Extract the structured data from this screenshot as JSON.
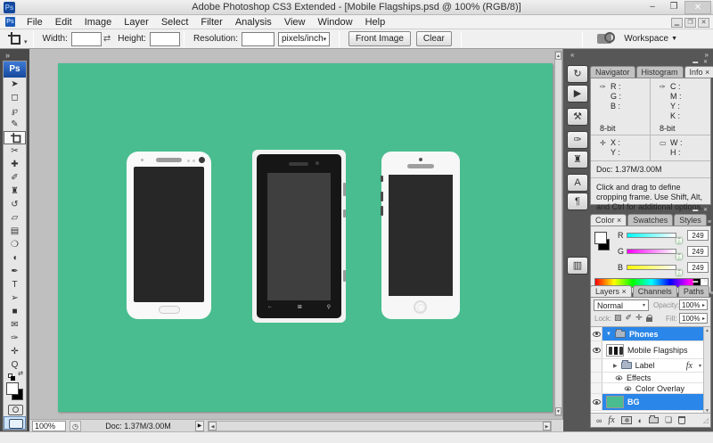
{
  "window": {
    "title": "Adobe Photoshop CS3 Extended - [Mobile Flagships.psd @ 100% (RGB/8)]",
    "logo": "Ps",
    "minimize_glyph": "–",
    "maximize_glyph": "❐",
    "close_glyph": "✕"
  },
  "doc_window": {
    "minimize_glyph": "▁",
    "restore_glyph": "❐",
    "close_glyph": "✕"
  },
  "menu": {
    "items": [
      "File",
      "Edit",
      "Image",
      "Layer",
      "Select",
      "Filter",
      "Analysis",
      "View",
      "Window",
      "Help"
    ],
    "doc_icon": "Ps"
  },
  "options": {
    "tool_caret": "▾",
    "width_label": "Width:",
    "width_value": "",
    "swap_glyph": "⇄",
    "height_label": "Height:",
    "height_value": "",
    "resolution_label": "Resolution:",
    "resolution_value": "",
    "unit": "pixels/inch",
    "unit_caret": "▾",
    "front_image": "Front Image",
    "clear": "Clear",
    "workspace": "Workspace",
    "workspace_caret": "▼"
  },
  "toolbox": {
    "collapse": "»",
    "logo": "Ps",
    "tools": [
      {
        "name": "move-tool",
        "glyph": "➤"
      },
      {
        "name": "rectangular-marquee-tool",
        "glyph": "◻"
      },
      {
        "name": "lasso-tool",
        "glyph": "℘"
      },
      {
        "name": "quick-selection-tool",
        "glyph": "✎"
      },
      {
        "name": "crop-tool",
        "glyph": ""
      },
      {
        "name": "slice-tool",
        "glyph": "✂"
      },
      {
        "name": "healing-brush-tool",
        "glyph": "✚"
      },
      {
        "name": "brush-tool",
        "glyph": "✐"
      },
      {
        "name": "clone-stamp-tool",
        "glyph": "♜"
      },
      {
        "name": "history-brush-tool",
        "glyph": "↺"
      },
      {
        "name": "eraser-tool",
        "glyph": "▱"
      },
      {
        "name": "gradient-tool",
        "glyph": "▤"
      },
      {
        "name": "blur-tool",
        "glyph": "❍"
      },
      {
        "name": "dodge-tool",
        "glyph": "◖"
      },
      {
        "name": "pen-tool",
        "glyph": "✒"
      },
      {
        "name": "type-tool",
        "glyph": "T"
      },
      {
        "name": "path-selection-tool",
        "glyph": "➢"
      },
      {
        "name": "rectangle-tool",
        "glyph": "■"
      },
      {
        "name": "notes-tool",
        "glyph": "✉"
      },
      {
        "name": "eyedropper-tool",
        "glyph": "✑"
      },
      {
        "name": "hand-tool",
        "glyph": "✛"
      },
      {
        "name": "zoom-tool",
        "glyph": "Q"
      }
    ],
    "mini_swap_glyph": "⇄"
  },
  "dock": {
    "collapse_left": "«",
    "collapse_right": "»",
    "icons": [
      {
        "name": "history-panel-icon",
        "glyph": "↻"
      },
      {
        "name": "actions-panel-icon",
        "glyph": "▶"
      },
      {
        "name": "tool-presets-panel-icon",
        "glyph": "⚒"
      },
      {
        "name": "brushes-panel-icon",
        "glyph": "✑"
      },
      {
        "name": "clone-source-panel-icon",
        "glyph": "♜"
      },
      {
        "name": "character-panel-icon",
        "glyph": "A"
      },
      {
        "name": "paragraph-panel-icon",
        "glyph": "¶"
      },
      {
        "name": "layer-comps-panel-icon",
        "glyph": "▥"
      }
    ]
  },
  "ui": {
    "caret_down": "▾",
    "caret_right": "▸",
    "scroll_up": "▲",
    "scroll_down": "▼",
    "scroll_left": "◀",
    "scroll_right": "▶",
    "panel_min": "▬",
    "panel_close": "✕",
    "panel_menu": "≡",
    "grip": "◿"
  },
  "panels": {
    "info": {
      "tabs": [
        "Navigator",
        "Histogram",
        "Info ×"
      ],
      "eyedropper_glyph": "✑",
      "rgb": [
        "R :",
        "G :",
        "B :"
      ],
      "cmyk": [
        "C :",
        "M :",
        "Y :",
        "K :"
      ],
      "bit_left": "8-bit",
      "bit_right": "8-bit",
      "crosshair_glyph": "✛",
      "rect_glyph": "▭",
      "xy": [
        "X :",
        "Y :"
      ],
      "wh": [
        "W :",
        "H :"
      ],
      "doc": "Doc: 1.37M/3.00M",
      "hint": "Click and drag to define cropping frame. Use Shift, Alt, and Ctrl for additional options."
    },
    "color": {
      "tabs": [
        "Color ×",
        "Swatches",
        "Styles"
      ],
      "sliders": [
        {
          "label": "R",
          "value": "249",
          "gradient": "cyan-to-white"
        },
        {
          "label": "G",
          "value": "249",
          "gradient": "magenta-to-white"
        },
        {
          "label": "B",
          "value": "249",
          "gradient": "yellow-to-white"
        }
      ]
    },
    "layers": {
      "tabs": [
        "Layers ×",
        "Channels",
        "Paths"
      ],
      "blend_mode": "Normal",
      "opacity_label": "Opacity:",
      "opacity_value": "100%",
      "lock_label": "Lock:",
      "fill_label": "Fill:",
      "fill_value": "100%",
      "rows": {
        "phones": "Phones",
        "mobile_flagships": "Mobile Flagships",
        "label": "Label",
        "label_fx": "fx",
        "effects": "Effects",
        "color_overlay": "Color Overlay",
        "bg": "BG"
      },
      "footer": {
        "link": "∞",
        "fx": "fx",
        "adjust": "◐",
        "new_layer": "❏"
      }
    }
  },
  "statusbar": {
    "zoom": "100%",
    "timer_glyph": "◷",
    "doc": "Doc: 1.37M/3.00M",
    "flyout_glyph": "▶"
  },
  "colors": {
    "canvas_green": "#49bd8f",
    "selection_blue": "#2a86e8"
  }
}
